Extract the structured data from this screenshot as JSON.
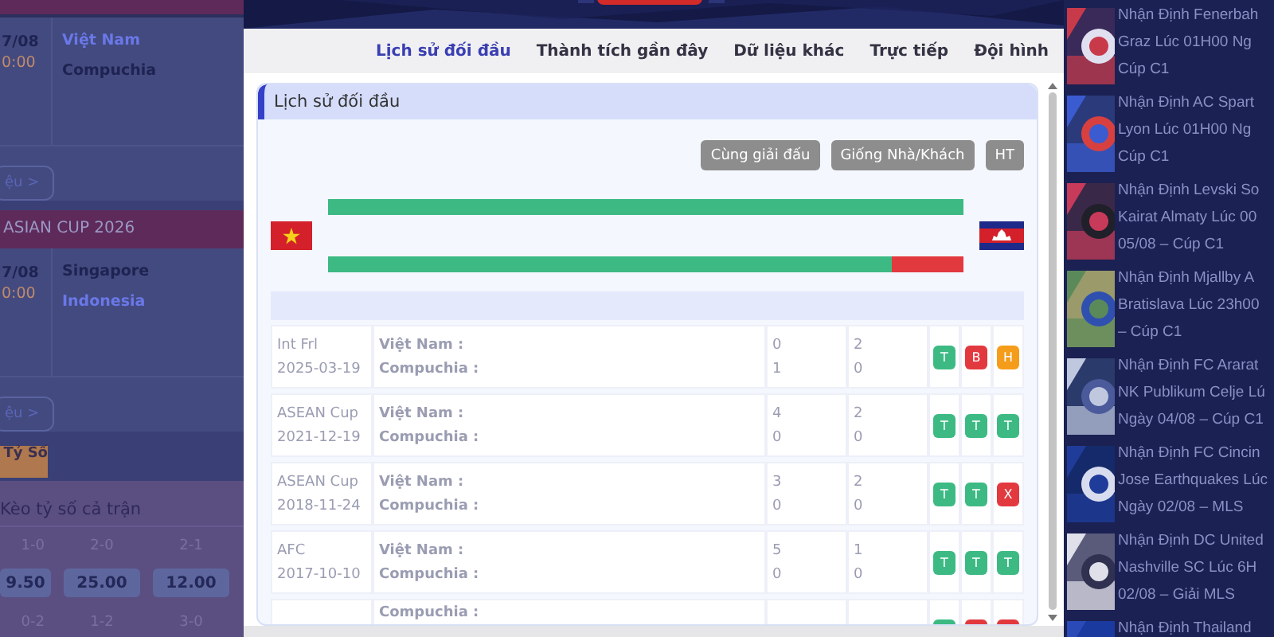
{
  "left_panel": {
    "matches": [
      {
        "date": "7/08",
        "time": "0:00",
        "teams": [
          {
            "name": "Việt Nam",
            "highlighted": true
          },
          {
            "name": "Compuchia",
            "highlighted": false
          }
        ],
        "button": "ệu >"
      },
      {
        "league": "ASIAN CUP 2026",
        "date": "7/08",
        "time": "0:00",
        "teams": [
          {
            "name": "Singapore",
            "highlighted": false
          },
          {
            "name": "Indonesia",
            "highlighted": true
          }
        ],
        "button": "ệu >"
      }
    ],
    "score_tab": "Tỷ Số",
    "score_section": {
      "title": "Kèo tỷ số cả trận",
      "cells": [
        {
          "score": "1-0",
          "odds": "9.50"
        },
        {
          "score": "2-0",
          "odds": "25.00"
        },
        {
          "score": "2-1",
          "odds": "12.00"
        }
      ],
      "next_scores": [
        "0-2",
        "1-2",
        "3-0"
      ]
    }
  },
  "modal": {
    "tabs": [
      {
        "label": "Lịch sử đối đầu",
        "selected": true
      },
      {
        "label": "Thành tích gần đây",
        "selected": false
      },
      {
        "label": "Dữ liệu khác",
        "selected": false
      },
      {
        "label": "Trực tiếp",
        "selected": false
      },
      {
        "label": "Đội hình",
        "selected": false
      }
    ],
    "section_title": "Lịch sử đối đầu",
    "filter_buttons": [
      "Cùng giải đấu",
      "Giống Nhà/Khách",
      "HT"
    ],
    "bars": [
      {
        "level": 1.0
      },
      {
        "level": 0.886
      }
    ],
    "rows": [
      {
        "competition": "Int Frl",
        "date": "2025-03-19",
        "home": "Việt Nam :",
        "away": "Compuchia :",
        "score_1": [
          "0",
          "1"
        ],
        "score_2": [
          "2",
          "0"
        ],
        "results": [
          {
            "label": "T",
            "color": "#3dba84"
          },
          {
            "label": "B",
            "color": "#e2393f"
          },
          {
            "label": "H",
            "color": "#f59c1a"
          }
        ]
      },
      {
        "competition": "ASEAN Cup",
        "date": "2021-12-19",
        "home": "Việt Nam :",
        "away": "Compuchia :",
        "score_1": [
          "4",
          "0"
        ],
        "score_2": [
          "2",
          "0"
        ],
        "results": [
          {
            "label": "T",
            "color": "#3dba84"
          },
          {
            "label": "T",
            "color": "#3dba84"
          },
          {
            "label": "T",
            "color": "#3dba84"
          }
        ]
      },
      {
        "competition": "ASEAN Cup",
        "date": "2018-11-24",
        "home": "Việt Nam :",
        "away": "Compuchia :",
        "score_1": [
          "3",
          "0"
        ],
        "score_2": [
          "2",
          "0"
        ],
        "results": [
          {
            "label": "T",
            "color": "#3dba84"
          },
          {
            "label": "T",
            "color": "#3dba84"
          },
          {
            "label": "X",
            "color": "#e2393f"
          }
        ]
      },
      {
        "competition": "AFC",
        "date": "2017-10-10",
        "home": "Việt Nam :",
        "away": "Compuchia :",
        "score_1": [
          "5",
          "0"
        ],
        "score_2": [
          "1",
          "0"
        ],
        "results": [
          {
            "label": "T",
            "color": "#3dba84"
          },
          {
            "label": "T",
            "color": "#3dba84"
          },
          {
            "label": "T",
            "color": "#3dba84"
          }
        ]
      },
      {
        "home": "Compuchia :",
        "results": [
          {
            "color": "#3dba84"
          },
          {
            "color": "#e2393f"
          },
          {
            "color": "#e2393f"
          }
        ]
      }
    ]
  },
  "news": [
    {
      "lines": [
        "Nhận Định Fenerbah",
        "Graz Lúc 01H00 Ng",
        "Cúp C1"
      ]
    },
    {
      "lines": [
        "Nhận Định AC Spart",
        "Lyon Lúc 01H00 Ng",
        "Cúp C1"
      ]
    },
    {
      "lines": [
        "Nhận Định Levski So",
        "Kairat Almaty Lúc 00",
        "05/08 – Cúp C1"
      ]
    },
    {
      "lines": [
        "Nhận Định Mjallby A",
        "Bratislava Lúc 23h00",
        "– Cúp C1"
      ]
    },
    {
      "lines": [
        "Nhận Định FC Ararat",
        "NK Publikum Celje Lú",
        "Ngày 04/08 – Cúp C1"
      ]
    },
    {
      "lines": [
        "Nhận Định FC Cincin",
        "Jose Earthquakes Lúc",
        "Ngày 02/08 – MLS"
      ]
    },
    {
      "lines": [
        "Nhận Định DC United",
        "Nashville SC Lúc 6H",
        "02/08 – Giải MLS"
      ]
    },
    {
      "lines": [
        "Nhận Định Thailand"
      ]
    }
  ]
}
